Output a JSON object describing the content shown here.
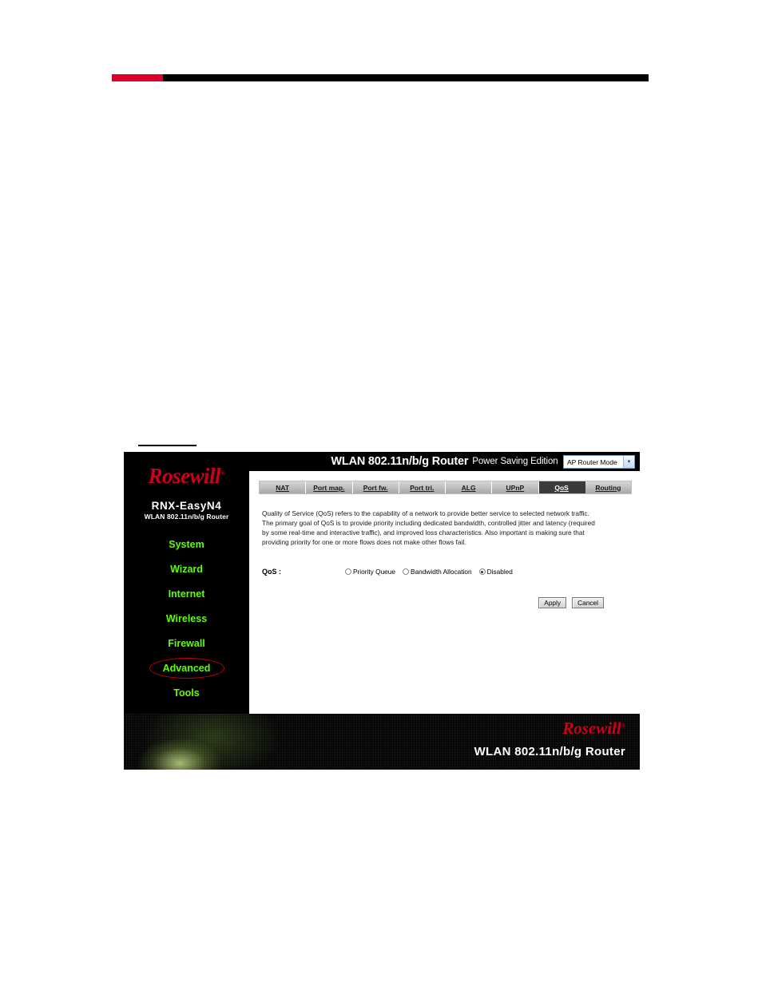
{
  "document": {
    "header_rule": {
      "accent_color": "#d9002b",
      "bar_color": "#000000"
    }
  },
  "screenshot": {
    "titlebar": {
      "title": "WLAN 802.11n/b/g Router",
      "subtitle": "Power Saving Edition",
      "mode_select": {
        "selected": "AP Router Mode",
        "arrow_icon": "chevron-down-icon",
        "options": [
          "AP Router Mode"
        ]
      }
    },
    "sidebar": {
      "logo_text": "Rosewill",
      "logo_color": "#cc0018",
      "model": "RNX-EasyN4",
      "model_sub": "WLAN 802.11n/b/g Router",
      "nav_color": "#5dff00",
      "items": [
        {
          "label": "System",
          "highlighted": false
        },
        {
          "label": "Wizard",
          "highlighted": false
        },
        {
          "label": "Internet",
          "highlighted": false
        },
        {
          "label": "Wireless",
          "highlighted": false
        },
        {
          "label": "Firewall",
          "highlighted": false
        },
        {
          "label": "Advanced",
          "highlighted": true
        },
        {
          "label": "Tools",
          "highlighted": false
        }
      ],
      "annotation_color": "#cc0000"
    },
    "tabs": [
      {
        "label": "NAT",
        "active": false
      },
      {
        "label": "Port map.",
        "active": false
      },
      {
        "label": "Port fw.",
        "active": false
      },
      {
        "label": "Port tri.",
        "active": false
      },
      {
        "label": "ALG",
        "active": false
      },
      {
        "label": "UPnP",
        "active": false
      },
      {
        "label": "QoS",
        "active": true
      },
      {
        "label": "Routing",
        "active": false
      }
    ],
    "content": {
      "description": "Quality of Service (QoS) refers to the capability of a network to provide better service to selected network traffic. The primary goal of QoS is to provide priority including dedicated bandwidth, controlled jitter and latency (required by some real-time and interactive traffic), and improved loss characteristics. Also important is making sure that providing priority for one or more flows does not make other flows fail.",
      "qos_label": "QoS :",
      "qos_options": [
        {
          "label": "Priority Queue",
          "checked": false
        },
        {
          "label": "Bandwidth Allocation",
          "checked": false
        },
        {
          "label": "Disabled",
          "checked": true
        }
      ],
      "apply_label": "Apply",
      "cancel_label": "Cancel"
    },
    "footer": {
      "logo_text": "Rosewill",
      "text": "WLAN 802.11n/b/g Router"
    }
  }
}
